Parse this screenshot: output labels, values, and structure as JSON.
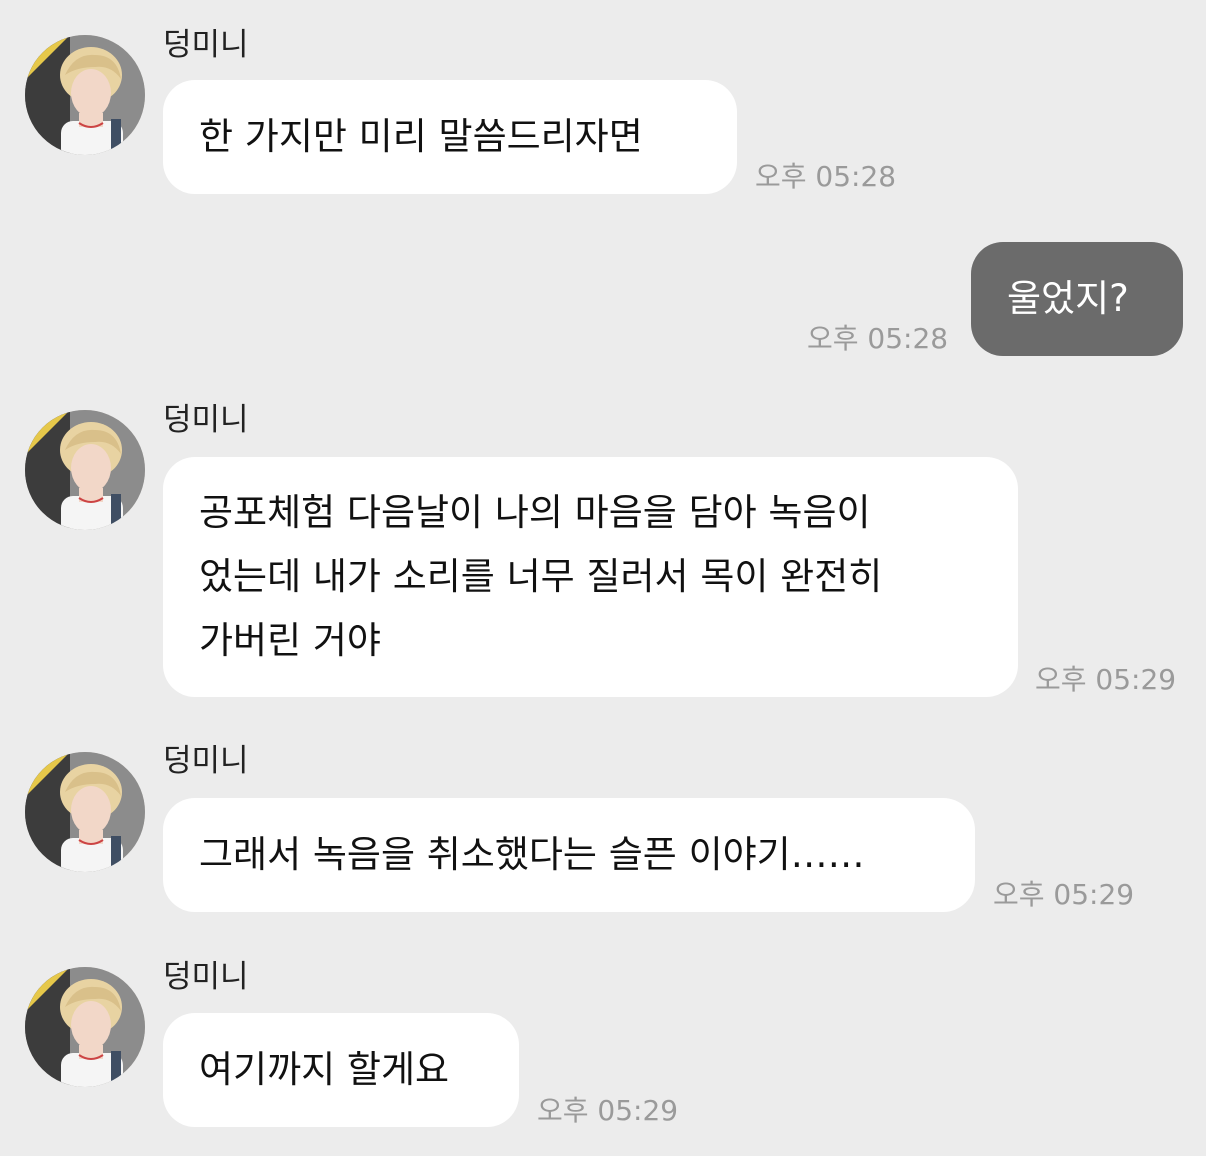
{
  "messages": [
    {
      "sender": "덩미니",
      "text": "한 가지만 미리 말씀드리자면",
      "time": "오후 05:28"
    },
    {
      "text": "울었지?",
      "time": "오후 05:28"
    },
    {
      "sender": "덩미니",
      "lines": [
        "공포체험 다음날이 나의 마음을 담아 녹음이",
        "었는데 내가 소리를 너무 질러서 목이 완전히",
        "가버린 거야"
      ],
      "time": "오후 05:29"
    },
    {
      "sender": "덩미니",
      "text": "그래서 녹음을 취소했다는 슬픈 이야기……",
      "time": "오후 05:29"
    },
    {
      "sender": "덩미니",
      "text": "여기까지 할게요",
      "time": "오후 05:29"
    }
  ],
  "colors": {
    "background": "#ececec",
    "incoming_bubble": "#ffffff",
    "outgoing_bubble": "#6b6b6b",
    "timestamp": "#9a9a9a"
  }
}
